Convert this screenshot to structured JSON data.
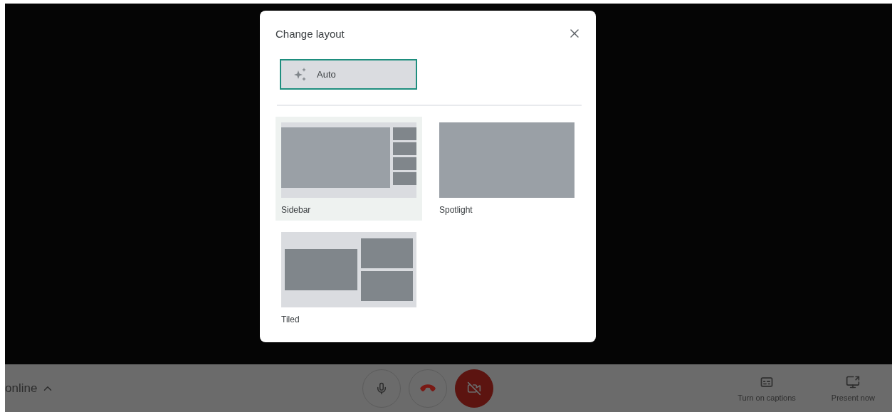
{
  "dialog": {
    "title": "Change layout",
    "auto": {
      "label": "Auto",
      "selected": true
    },
    "layouts": [
      {
        "kind": "sidebar",
        "label": "Sidebar",
        "highlighted": true
      },
      {
        "kind": "spotlight",
        "label": "Spotlight",
        "highlighted": false
      },
      {
        "kind": "tiled",
        "label": "Tiled",
        "highlighted": false
      }
    ]
  },
  "bottom_bar": {
    "meeting_info": "online",
    "camera_off": true,
    "actions": [
      {
        "kind": "captions",
        "label": "Turn on captions"
      },
      {
        "kind": "present",
        "label": "Present now"
      }
    ]
  }
}
